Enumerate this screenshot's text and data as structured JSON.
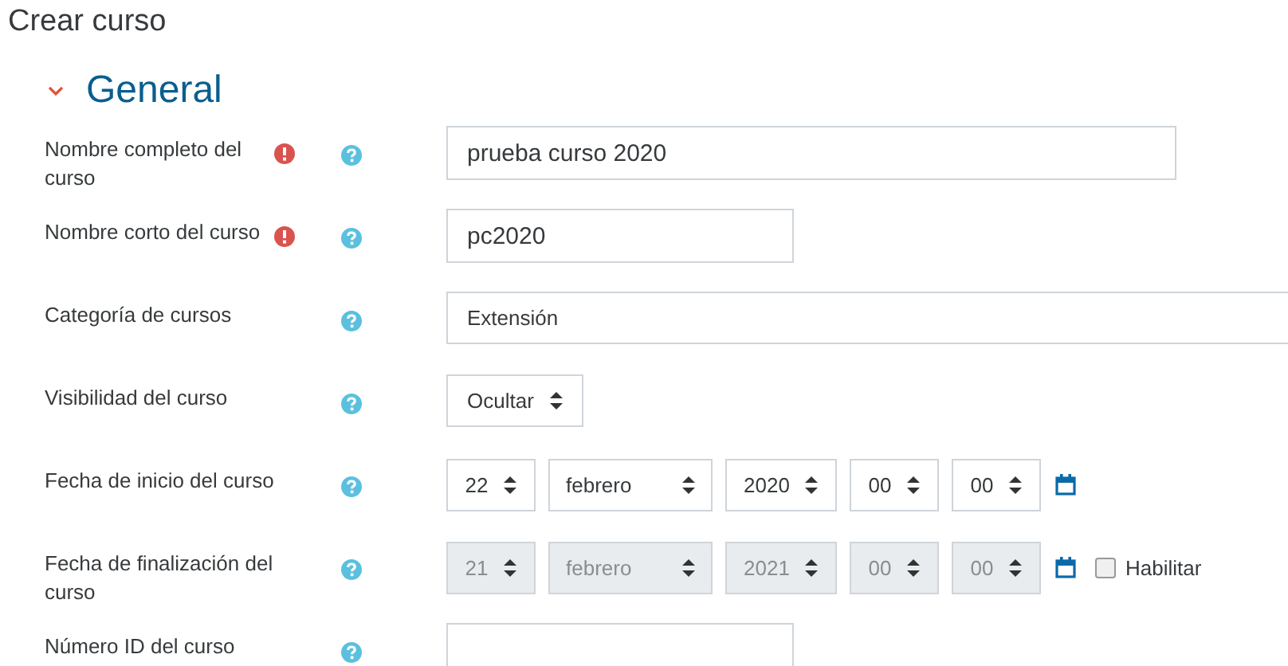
{
  "page_title": "Crear curso",
  "section": {
    "title": "General",
    "expanded": true
  },
  "fields": [
    {
      "kind": "text",
      "label": "Nombre completo del curso",
      "required": true,
      "value": "prueba curso 2020"
    },
    {
      "kind": "text",
      "label": "Nombre corto del curso",
      "required": true,
      "value": "pc2020"
    },
    {
      "kind": "select",
      "label": "Categoría de cursos",
      "required": false,
      "value": "Extensión"
    },
    {
      "kind": "select",
      "label": "Visibilidad del curso",
      "required": false,
      "value": "Ocultar"
    },
    {
      "kind": "date",
      "label": "Fecha de inicio del curso",
      "required": false,
      "disabled": false,
      "parts": [
        "22",
        "febrero",
        "2020",
        "00",
        "00"
      ]
    },
    {
      "kind": "date",
      "label": "Fecha de finalización del curso",
      "required": false,
      "disabled": true,
      "parts": [
        "21",
        "febrero",
        "2021",
        "00",
        "00"
      ],
      "enable": {
        "label": "Habilitar",
        "checked": false
      }
    },
    {
      "kind": "text",
      "label": "Número ID del curso",
      "required": false
    }
  ]
}
